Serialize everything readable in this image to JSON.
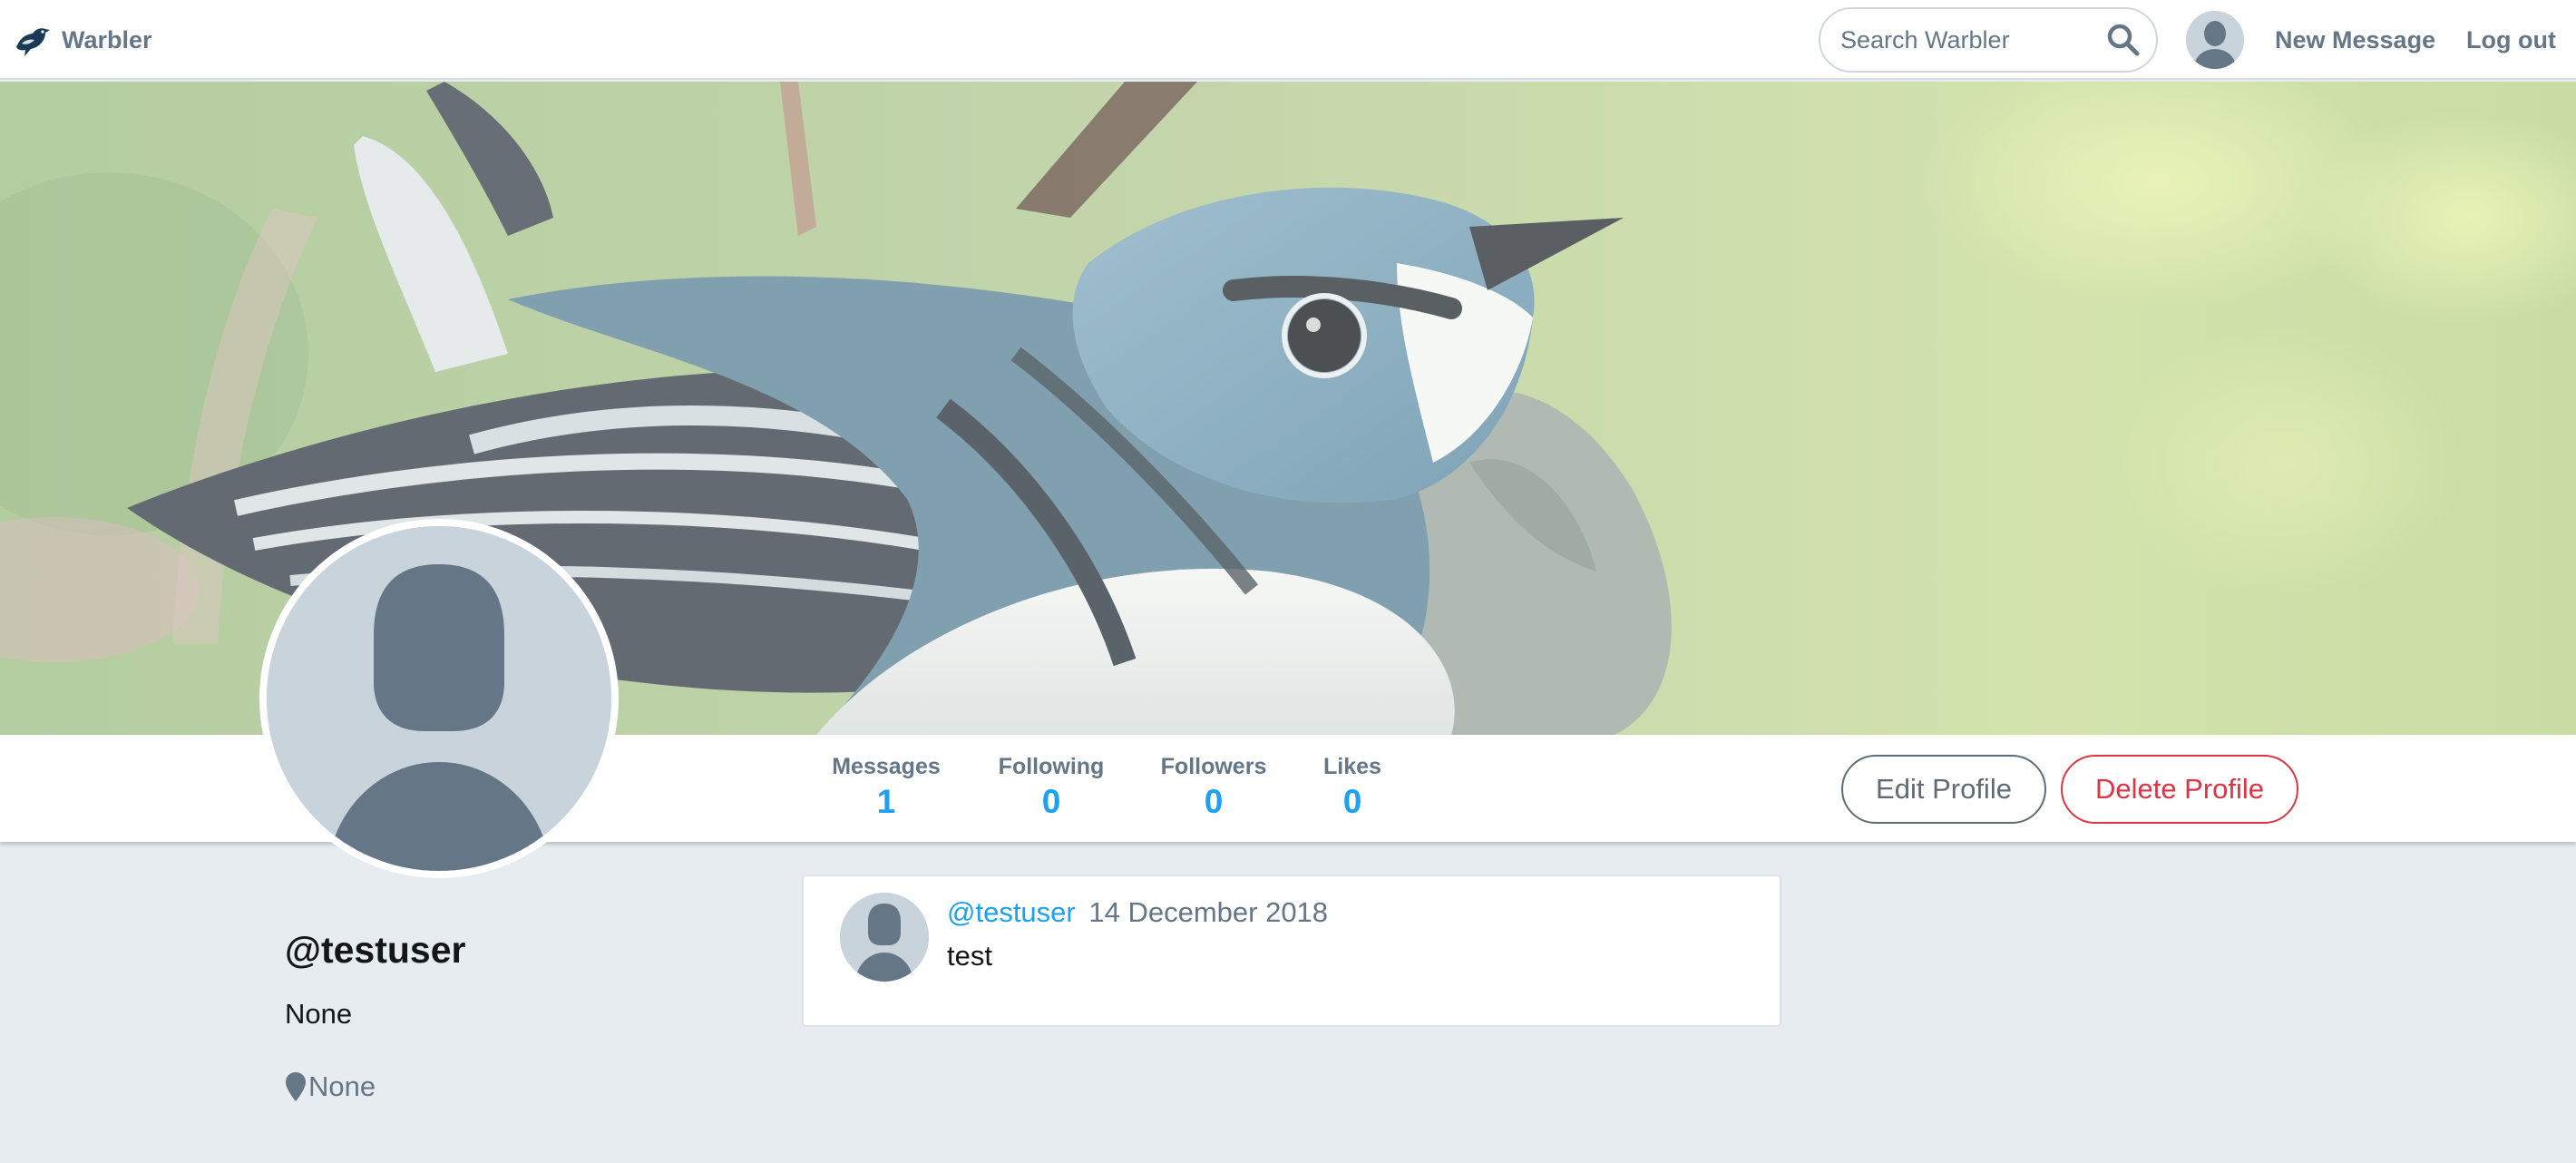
{
  "navbar": {
    "brand": "Warbler",
    "search_placeholder": "Search Warbler",
    "new_message": "New Message",
    "logout": "Log out"
  },
  "profile": {
    "stats": [
      {
        "label": "Messages",
        "value": "1"
      },
      {
        "label": "Following",
        "value": "0"
      },
      {
        "label": "Followers",
        "value": "0"
      },
      {
        "label": "Likes",
        "value": "0"
      }
    ],
    "edit_button": "Edit Profile",
    "delete_button": "Delete Profile",
    "username": "@testuser",
    "bio": "None",
    "location": "None"
  },
  "messages": [
    {
      "user": "@testuser",
      "date": "14 December 2018",
      "text": "test"
    }
  ],
  "colors": {
    "accent": "#1da1f2",
    "danger": "#dc3545",
    "muted": "#657786",
    "page_bg": "#e6ecf0"
  },
  "icons": {
    "brand": "warbler-bird-icon",
    "search": "search-icon",
    "location": "map-pin-icon",
    "avatar": "default-user-icon"
  }
}
